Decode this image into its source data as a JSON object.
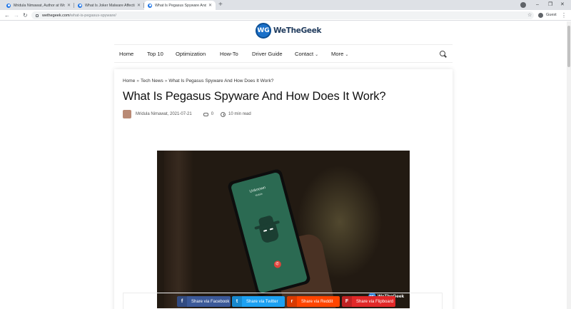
{
  "browser": {
    "tabs": [
      {
        "title": "Mridula Nimawat, Author at Wo",
        "active": false
      },
      {
        "title": "What Is Joker Malware Affectin",
        "active": false
      },
      {
        "title": "What Is Pegasus Spyware And H",
        "active": true
      }
    ],
    "tab_close": "✕",
    "new_tab": "+",
    "window_controls": {
      "minimize": "–",
      "maximize": "❐",
      "close": "✕"
    },
    "nav": {
      "back": "←",
      "forward": "→",
      "reload": "↻"
    },
    "url_host": "wethegeek.com",
    "url_path": "/what-is-pegasus-spyware/",
    "bookmark_star": "☆",
    "profile_label": "Guest",
    "menu": "⋮"
  },
  "site": {
    "logo_mark": "WG",
    "logo_text": "WeTheGeek",
    "nav": [
      {
        "label": "Home",
        "dropdown": false
      },
      {
        "label": "Top 10",
        "dropdown": false
      },
      {
        "label": "Optimization",
        "dropdown": false
      },
      {
        "label": "How-To",
        "dropdown": false
      },
      {
        "label": "Driver Guide",
        "dropdown": false
      },
      {
        "label": "Contact",
        "dropdown": true
      },
      {
        "label": "More",
        "dropdown": true
      }
    ],
    "chevron": "⌄"
  },
  "article": {
    "breadcrumb": [
      "Home",
      "Tech News",
      "What Is Pegasus Spyware And How Does It Work?"
    ],
    "breadcrumb_sep": "»",
    "title": "What Is Pegasus Spyware And How Does It Work?",
    "author_date": "Mridula Nimawat, 2021-07-21",
    "comments": "0",
    "read_time": "10 min read",
    "image": {
      "caller": "Unknown",
      "caller_sub": "Mobile",
      "end_call_icon": "✆",
      "watermark_mark": "WG",
      "watermark_text": "WeTheGeek"
    }
  },
  "share": [
    {
      "label": "Share via Facebook",
      "icon": "f",
      "color": "#3b5998"
    },
    {
      "label": "Share via Twitter",
      "icon": "t",
      "color": "#1da1f2"
    },
    {
      "label": "Share via Reddit",
      "icon": "r",
      "color": "#ff4500"
    },
    {
      "label": "Share via Flipboard",
      "icon": "F",
      "color": "#e12828"
    }
  ]
}
